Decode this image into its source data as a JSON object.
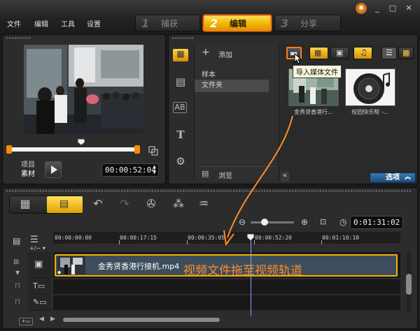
{
  "menu": {
    "file": "文件",
    "edit": "编辑",
    "tools": "工具",
    "settings": "设置"
  },
  "steps": [
    {
      "num": "1",
      "label": "捕获"
    },
    {
      "num": "2",
      "label": "编辑"
    },
    {
      "num": "3",
      "label": "分享"
    }
  ],
  "window_buttons": {
    "minimize": "_",
    "maximize": "□",
    "close": "✕"
  },
  "preview": {
    "mode_project": "项目",
    "mode_clip": "素材",
    "timecode": "00:00:52:04"
  },
  "library": {
    "add_label": "添加",
    "items": [
      "样本",
      "文件夹"
    ],
    "browse_label": "浏览",
    "tooltip": "导入媒体文件",
    "thumbs": [
      {
        "label": "金秀贤香港行…"
      },
      {
        "label": "校园快乐帮 -…"
      }
    ],
    "options_label": "选项"
  },
  "timeline": {
    "timecode": "0:01:31:02",
    "ruler": [
      "00:00:00:00",
      "00:00:17:15",
      "00:00:35:05",
      "00:00:52:20",
      "00:01:10:10"
    ],
    "add_track": "+/− ▾",
    "clip_label": "金秀贤香港行接机.mp4"
  },
  "annotation": "视频文件拖至视频轨道",
  "colors": {
    "accent_orange": "#ff8c2a",
    "tab_gold": "#f2b500",
    "options_blue": "#2a5f94",
    "playhead": "#8aa6ff"
  }
}
